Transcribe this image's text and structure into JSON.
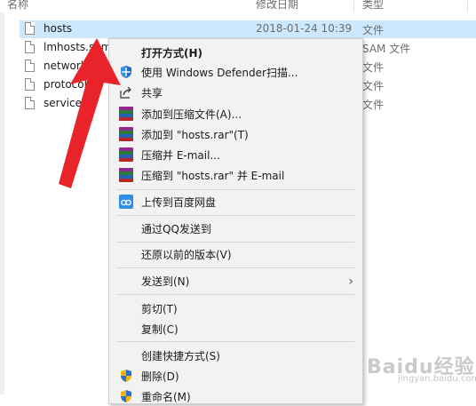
{
  "columns": {
    "name": "名称",
    "date": "修改日期",
    "type": "类型"
  },
  "files": [
    {
      "name": "hosts",
      "date": "2018-01-24 10:39",
      "type": "文件",
      "selected": true
    },
    {
      "name": "lmhosts.sam",
      "date": "",
      "type": "SAM 文件"
    },
    {
      "name": "network",
      "date": "",
      "type": "文件"
    },
    {
      "name": "protocol",
      "date": "",
      "type": "文件"
    },
    {
      "name": "services",
      "date": "",
      "type": "文件"
    }
  ],
  "menu": {
    "open_with": "打开方式(H)",
    "defender": "使用 Windows Defender扫描...",
    "share": "共享",
    "add_archive": "添加到压缩文件(A)...",
    "add_rar": "添加到 \"hosts.rar\"(T)",
    "compress_email": "压缩并 E-mail...",
    "compress_rar_email": "压缩到 \"hosts.rar\" 并 E-mail",
    "baidu_upload": "上传到百度网盘",
    "qq_send": "通过QQ发送到",
    "restore": "还原以前的版本(V)",
    "send_to": "发送到(N)",
    "cut": "剪切(T)",
    "copy": "复制(C)",
    "create_shortcut": "创建快捷方式(S)",
    "delete": "删除(D)",
    "rename": "重命名(M)"
  },
  "watermark": {
    "brand": "Baidu经验",
    "sub": "jingyan.baidu.com"
  },
  "colors": {
    "selection": "#cce8ff",
    "menu_bg": "#f2f2f2",
    "arrow": "#e8232a"
  },
  "icons": [
    "file-icon",
    "defender-shield-icon",
    "share-icon",
    "winrar-icon",
    "baidu-cloud-icon",
    "uac-shield-icon",
    "chevron-right-icon"
  ]
}
